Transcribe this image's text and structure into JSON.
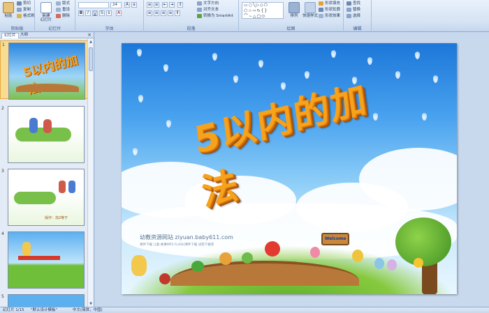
{
  "ribbon": {
    "clipboard": {
      "label": "剪贴板",
      "paste": "粘贴",
      "cut": "剪切",
      "copy": "复制",
      "format_painter": "格式刷"
    },
    "slides": {
      "label": "幻灯片",
      "new_slide": "新建\n幻灯片",
      "layout": "版式",
      "reset": "重设",
      "delete": "删除"
    },
    "font": {
      "label": "字体",
      "font_name": "",
      "font_size": "24"
    },
    "paragraph": {
      "label": "段落",
      "text_direction": "文字方向",
      "align_text": "对齐文本",
      "smartart": "转换为 SmartArt"
    },
    "drawing": {
      "label": "绘图",
      "arrange": "排列",
      "quick_styles": "快速样式",
      "shape_fill": "形状填充",
      "shape_outline": "形状轮廓",
      "shape_effects": "形状效果"
    },
    "editing": {
      "label": "编辑",
      "find": "查找",
      "replace": "替换",
      "select": "选择"
    }
  },
  "panel": {
    "tabs": [
      "幻灯片",
      "大纲"
    ],
    "close": "×",
    "slides": [
      {
        "num": "1",
        "selected": true
      },
      {
        "num": "2"
      },
      {
        "num": "3",
        "caption": "操作：加2等于"
      },
      {
        "num": "4"
      },
      {
        "num": "5"
      }
    ]
  },
  "slide": {
    "title": "5以内的加法",
    "site_line": "幼教资源网站  ziyuan.baby611.com",
    "site_sub": "课件下载  儿歌  故事MP3  FLASH课件下载  试卷下载等",
    "sign": "Welcome"
  },
  "status": {
    "slide_indicator": "幻灯片 1/15",
    "theme": "\"默认设计模板\"",
    "language": "中文(简体，中国)"
  },
  "colors": {
    "ribbon_bg": "#d5e3f4",
    "selected_thumb": "#f8dc92",
    "title_orange": "#f7a21b"
  }
}
